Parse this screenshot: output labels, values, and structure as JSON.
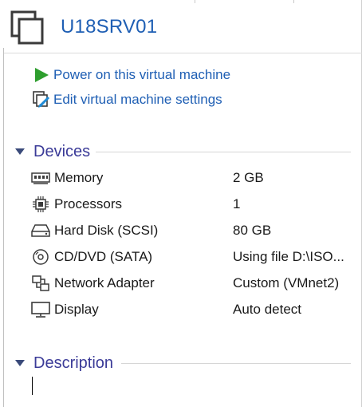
{
  "vm": {
    "title": "U18SRV01"
  },
  "actions": [
    {
      "label": "Power on this virtual machine",
      "icon": "play-icon"
    },
    {
      "label": "Edit virtual machine settings",
      "icon": "edit-settings-icon"
    }
  ],
  "devices": {
    "title": "Devices",
    "items": [
      {
        "name": "Memory",
        "value": "2 GB",
        "icon": "memory-icon"
      },
      {
        "name": "Processors",
        "value": "1",
        "icon": "processor-icon"
      },
      {
        "name": "Hard Disk (SCSI)",
        "value": "80 GB",
        "icon": "hard-disk-icon"
      },
      {
        "name": "CD/DVD (SATA)",
        "value": "Using file D:\\ISO...",
        "icon": "cd-dvd-icon"
      },
      {
        "name": "Network Adapter",
        "value": "Custom (VMnet2)",
        "icon": "network-adapter-icon"
      },
      {
        "name": "Display",
        "value": "Auto detect",
        "icon": "display-icon"
      }
    ]
  },
  "description": {
    "title": "Description",
    "text": ""
  },
  "colors": {
    "link": "#1f5fb4",
    "section": "#3b3b98",
    "play": "#2e9e2e"
  }
}
